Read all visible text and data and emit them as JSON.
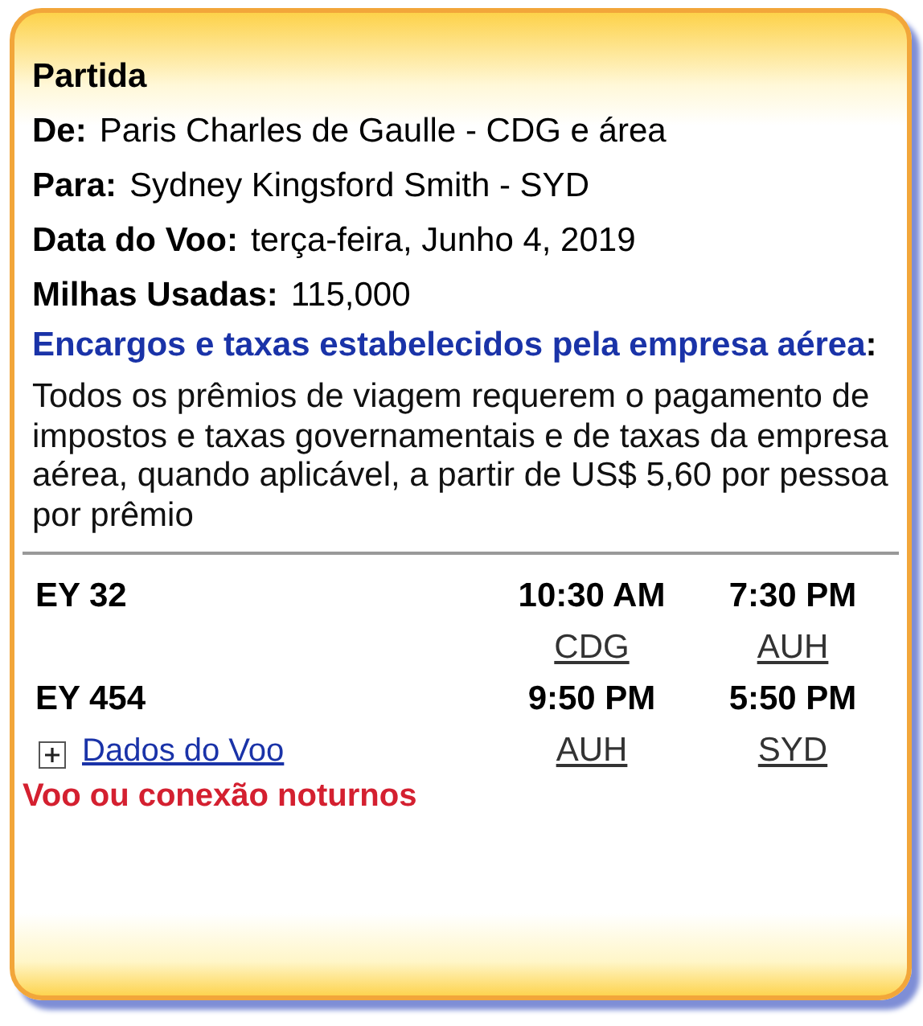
{
  "section_title": "Partida",
  "details": [
    {
      "label": "De:",
      "value": "Paris Charles de Gaulle - CDG e área"
    },
    {
      "label": "Para:",
      "value": "Sydney Kingsford Smith - SYD"
    },
    {
      "label": "Data do Voo:",
      "value": "terça-feira, Junho 4, 2019"
    },
    {
      "label": "Milhas Usadas:",
      "value": "115,000"
    }
  ],
  "fees": {
    "link": "Encargos e taxas estabelecidos pela empresa aérea",
    "suffix": ":",
    "text": "Todos os prêmios de viagem requerem o pagamento de impostos e taxas governamentais e de taxas da empresa aérea, quando aplicável, a partir de US$ 5,60 por pessoa por prêmio"
  },
  "flights": [
    {
      "number": "EY 32",
      "departure_time": "10:30 AM",
      "arrival_time": "7:30 PM",
      "from": "CDG",
      "to": "AUH"
    },
    {
      "number": "EY 454",
      "departure_time": "9:50 PM",
      "arrival_time": "5:50 PM",
      "from": "AUH",
      "to": "SYD"
    }
  ],
  "flight_details_link": "Dados do Voo",
  "warning": "Voo ou conexão noturnos"
}
